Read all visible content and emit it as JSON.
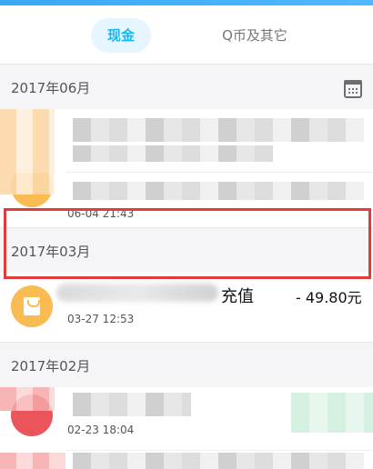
{
  "tabs": {
    "cash": "现金",
    "qcoin": "Q币及其它"
  },
  "sections": [
    {
      "month": "2017年06月"
    },
    {
      "month": "2017年03月"
    },
    {
      "month": "2017年02月"
    }
  ],
  "transactions": {
    "jun_second_time": "06-04 21:43",
    "mar_title": "充值",
    "mar_amount": "- 49.80元",
    "mar_time": "03-27 12:53",
    "feb_time": "02-23 18:04"
  },
  "icons": {
    "calendar": "calendar-icon",
    "recharge": "shopping-bag-icon"
  },
  "colors": {
    "accent": "#12b7f5",
    "highlight": "#e23b3b",
    "avatar_yellow": "#f8bc52",
    "avatar_red": "#e9555a"
  }
}
